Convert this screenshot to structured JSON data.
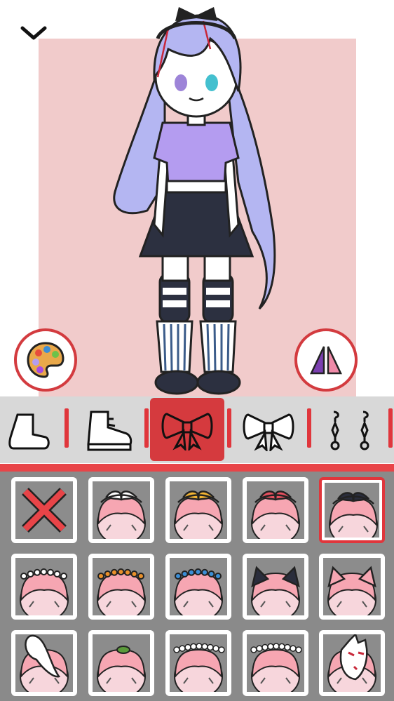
{
  "screen": {
    "collapse_icon": "chevron-down-icon",
    "backdrop_color": "#f1cbcb",
    "accent_color": "#e0363c"
  },
  "buttons": {
    "palette_icon": "palette-icon",
    "flip_icon": "flip-mirror-icon"
  },
  "categories": [
    {
      "id": "socks",
      "icon": "sock-icon",
      "active": false
    },
    {
      "id": "shoes",
      "icon": "shoe-icon",
      "active": false
    },
    {
      "id": "hair-accessory-front",
      "icon": "bow-filled-icon",
      "active": true
    },
    {
      "id": "hair-accessory-back",
      "icon": "bow-outline-icon",
      "active": false
    },
    {
      "id": "earrings",
      "icon": "earring-icon",
      "active": false
    }
  ],
  "items": [
    {
      "id": "none",
      "icon": "remove-x-icon",
      "selected": false
    },
    {
      "id": "ribbon-white",
      "color": "#ffffff",
      "kind": "ribbon",
      "selected": false
    },
    {
      "id": "ribbon-yellow",
      "color": "#f2b433",
      "kind": "ribbon",
      "selected": false
    },
    {
      "id": "ribbon-red",
      "color": "#e8505f",
      "kind": "ribbon",
      "selected": false
    },
    {
      "id": "ribbon-black",
      "color": "#2a2d3c",
      "kind": "ribbon",
      "selected": true
    },
    {
      "id": "flowers-white",
      "color": "#ffffff",
      "kind": "flowers",
      "selected": false
    },
    {
      "id": "flowers-orange",
      "color": "#e9902a",
      "kind": "flowers",
      "selected": false
    },
    {
      "id": "flowers-blue",
      "color": "#3b8ed6",
      "kind": "flowers",
      "selected": false
    },
    {
      "id": "ears-black",
      "color": "#2a2d3c",
      "kind": "ears",
      "selected": false
    },
    {
      "id": "ears-pink",
      "color": "#f6a6b2",
      "kind": "ears",
      "selected": false
    },
    {
      "id": "bunny-ear",
      "color": "#ffffff",
      "kind": "bunny",
      "selected": false
    },
    {
      "id": "leaf-clip",
      "color": "#5b9a3a",
      "kind": "leaf",
      "selected": false
    },
    {
      "id": "lace-white",
      "color": "#ffffff",
      "kind": "lace",
      "selected": false
    },
    {
      "id": "lace-white-2",
      "color": "#ffffff",
      "kind": "lace",
      "selected": false
    },
    {
      "id": "fox-mask",
      "color": "#ffffff",
      "kind": "mask",
      "selected": false
    }
  ]
}
